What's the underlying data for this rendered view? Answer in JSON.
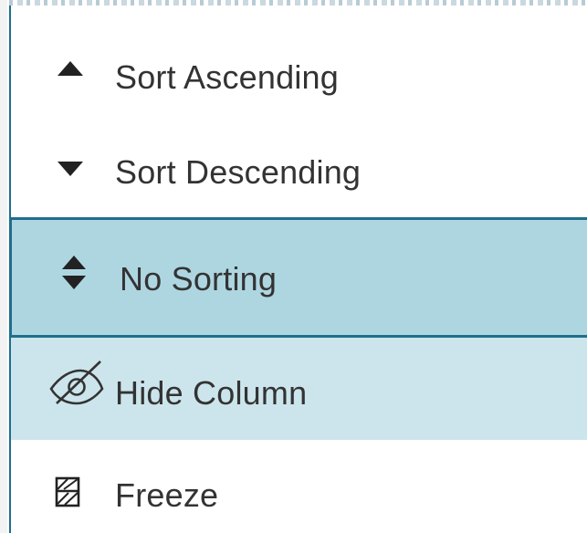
{
  "menu": {
    "items": [
      {
        "label": "Sort Ascending",
        "icon": "triangle-up-icon"
      },
      {
        "label": "Sort Descending",
        "icon": "triangle-down-icon"
      },
      {
        "label": "No Sorting",
        "icon": "sort-both-icon",
        "state": "selected"
      },
      {
        "label": "Hide Column",
        "icon": "eye-slash-icon",
        "state": "hover"
      },
      {
        "label": "Freeze",
        "icon": "freeze-icon"
      }
    ]
  },
  "colors": {
    "selected_bg": "#aed6e1",
    "selected_border": "#1f6f8b",
    "hover_bg": "#cce5ec",
    "text": "#333333"
  }
}
